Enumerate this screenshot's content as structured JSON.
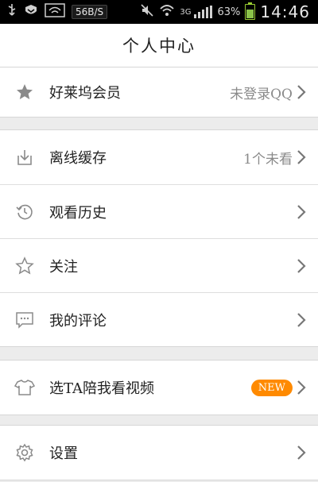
{
  "status_bar": {
    "net_speed": "56B/S",
    "network_type": "3G",
    "battery_percent": "63%",
    "time": "14:46"
  },
  "header": {
    "title": "个人中心"
  },
  "groups": [
    {
      "items": [
        {
          "label": "好莱坞会员",
          "value": "未登录QQ",
          "icon": "star-icon"
        }
      ]
    },
    {
      "items": [
        {
          "label": "离线缓存",
          "value": "1个未看",
          "icon": "download-icon"
        },
        {
          "label": "观看历史",
          "value": "",
          "icon": "history-icon"
        },
        {
          "label": "关注",
          "value": "",
          "icon": "star-outline-icon"
        },
        {
          "label": "我的评论",
          "value": "",
          "icon": "comment-icon"
        }
      ]
    },
    {
      "items": [
        {
          "label": "选TA陪我看视频",
          "badge": "NEW",
          "icon": "tshirt-icon"
        }
      ]
    },
    {
      "items": [
        {
          "label": "设置",
          "value": "",
          "icon": "gear-icon"
        }
      ]
    }
  ],
  "colors": {
    "accent": "#2196f3",
    "badge": "#ff8a00"
  }
}
